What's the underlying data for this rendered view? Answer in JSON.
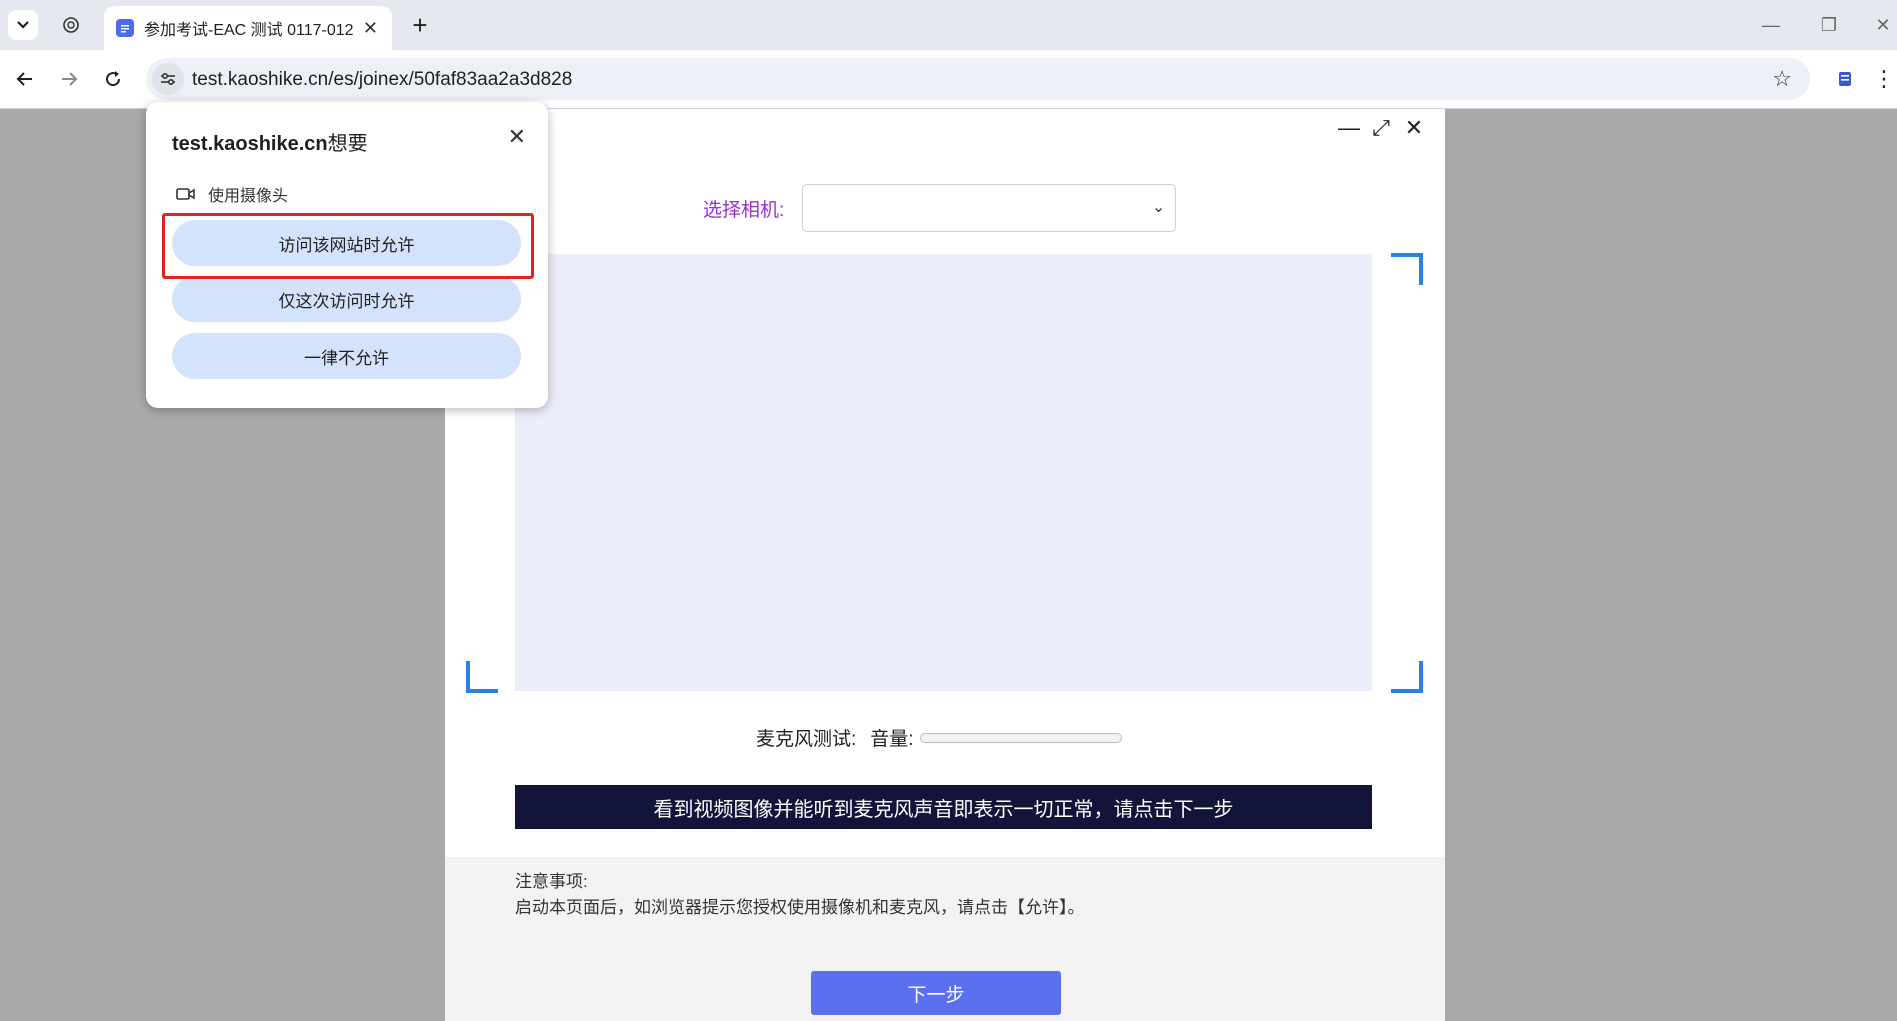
{
  "browser": {
    "tab": {
      "title": "参加考试-EAC 测试 0117-012",
      "close": "✕"
    },
    "new_tab": "+",
    "url": "test.kaoshike.cn/es/joinex/50faf83aa2a3d828",
    "window_controls": {
      "minimize": "—",
      "restore": "❐",
      "close": "✕"
    }
  },
  "permission_popup": {
    "site": "test.kaoshike.cn",
    "wants": "想要",
    "permission": "使用摄像头",
    "close": "✕",
    "buttons": {
      "allow_always": "访问该网站时允许",
      "allow_once": "仅这次访问时允许",
      "never": "一律不允许"
    }
  },
  "modal": {
    "controls": {
      "minimize": "—",
      "maximize": "⤢",
      "close": "✕"
    },
    "camera_label": "选择相机:",
    "camera_selected": "",
    "mic_label": "麦克风测试:",
    "volume_label": "音量:",
    "volume_level": 0,
    "banner": "看到视频图像并能听到麦克风声音即表示一切正常，请点击下一步",
    "notes_title": "注意事项:",
    "notes_text": "启动本页面后，如浏览器提示您授权使用摄像机和麦克风，请点击【允许】。",
    "next_button": "下一步"
  },
  "colors": {
    "accent": "#5a70f0",
    "camera_label": "#9b30d9",
    "banner_bg": "#12143a",
    "corner": "#2a82e4",
    "highlight": "#e0251e",
    "permission_button": "#d4e3fc"
  }
}
